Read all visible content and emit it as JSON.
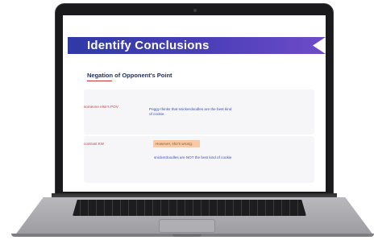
{
  "slide": {
    "title": "Identify Conclusions",
    "subtitle": "Negation of Opponent's Point",
    "rows": [
      {
        "label": "someone else's POV",
        "text_line1": "Peggy thinks that snickerdoodles are the best kind",
        "text_line2": "of cookie."
      },
      {
        "label": "contrast KW",
        "highlight": "However, she's wrong.",
        "text_line1": "snickerdoodles are NOT the best kind of cookie"
      }
    ]
  },
  "colors": {
    "banner_start": "#2e3aa6",
    "banner_end": "#6e4bc9",
    "label_red": "#c8414a",
    "text_blue": "#3b4fb0",
    "highlight": "#f8c9a3"
  }
}
